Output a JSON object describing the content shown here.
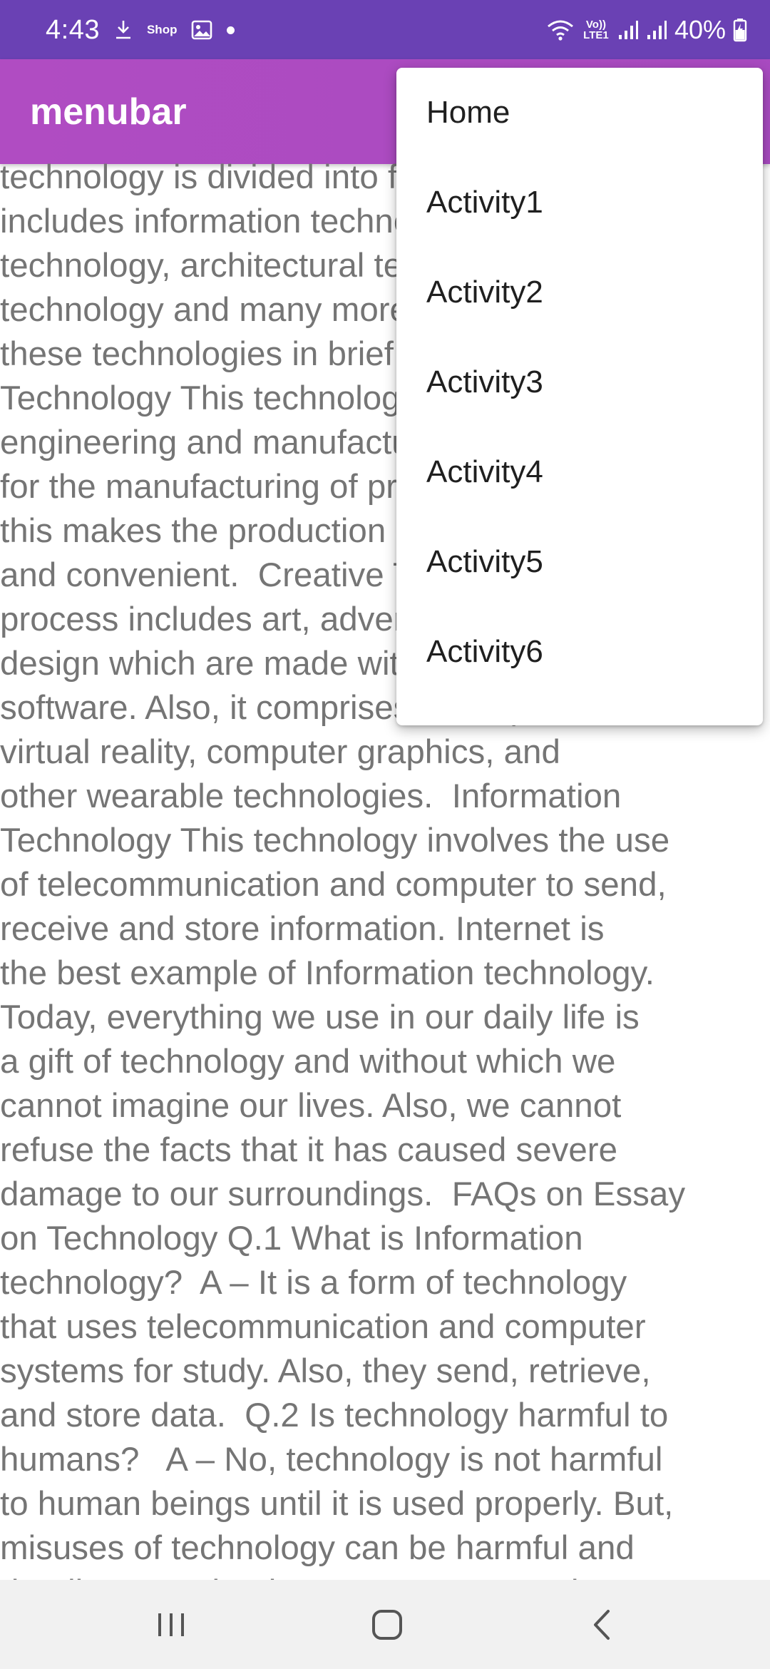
{
  "status_bar": {
    "time": "4:43",
    "shop_label": "Shop",
    "volte_label": "Vo)) LTE1",
    "battery": "40%",
    "background_color": "#6a41b4"
  },
  "app_bar": {
    "title": "menubar",
    "background_color": "#b04cc2"
  },
  "content": {
    "lines": [
      "technology is divided into four types which",
      "includes information technology, medical",
      "technology, architectural technology, business",
      "technology and many more. Let us discuss",
      "these technologies in brief.  Manufacturing",
      "Technology This technology helps in",
      "engineering and manufacturing of products",
      "for the manufacturing of products which",
      "this makes the production process easy",
      "and convenient.  Creative Technology This",
      "process includes art, advertising, and product",
      "design which are made with the help of",
      "software. Also, it comprises of 3D printers,",
      "virtual reality, computer graphics, and",
      "other wearable technologies.  Information",
      "Technology This technology involves the use",
      "of telecommunication and computer to send,",
      "receive and store information. Internet is",
      "the best example of Information technology.",
      "Today, everything we use in our daily life is",
      "a gift of technology and without which we",
      "cannot imagine our lives. Also, we cannot",
      "refuse the facts that it has caused severe",
      "damage to our surroundings.  FAQs on Essay",
      "on Technology Q.1 What is Information",
      "technology?  A – It is a form of technology",
      "that uses telecommunication and computer",
      "systems for study. Also, they send, retrieve,",
      "and store data.  Q.2 Is technology harmful to",
      "humans?   A – No, technology is not harmful",
      "to human beings until it is used properly. But,",
      "misuses of technology can be harmful and",
      "deadly.  Download Toppr – Best Learning App"
    ]
  },
  "menu": {
    "items": [
      {
        "label": "Home"
      },
      {
        "label": "Activity1"
      },
      {
        "label": "Activity2"
      },
      {
        "label": "Activity3"
      },
      {
        "label": "Activity4"
      },
      {
        "label": "Activity5"
      },
      {
        "label": "Activity6"
      }
    ]
  },
  "nav_bar": {
    "icons": [
      "recent-apps-icon",
      "home-icon",
      "back-icon"
    ]
  }
}
